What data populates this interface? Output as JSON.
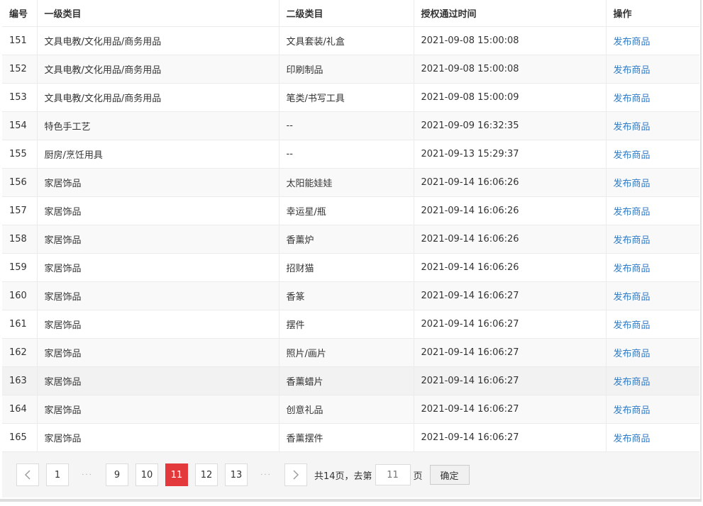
{
  "table": {
    "headers": {
      "id": "编号",
      "level1": "一级类目",
      "level2": "二级类目",
      "time": "授权通过时间",
      "action": "操作"
    },
    "rows": [
      {
        "id": "151",
        "level1": "文具电教/文化用品/商务用品",
        "level2": "文具套装/礼盒",
        "time": "2021-09-08 15:00:08",
        "action": "发布商品"
      },
      {
        "id": "152",
        "level1": "文具电教/文化用品/商务用品",
        "level2": "印刷制品",
        "time": "2021-09-08 15:00:08",
        "action": "发布商品"
      },
      {
        "id": "153",
        "level1": "文具电教/文化用品/商务用品",
        "level2": "笔类/书写工具",
        "time": "2021-09-08 15:00:09",
        "action": "发布商品"
      },
      {
        "id": "154",
        "level1": "特色手工艺",
        "level2": "--",
        "time": "2021-09-09 16:32:35",
        "action": "发布商品"
      },
      {
        "id": "155",
        "level1": "厨房/烹饪用具",
        "level2": "--",
        "time": "2021-09-13 15:29:37",
        "action": "发布商品"
      },
      {
        "id": "156",
        "level1": "家居饰品",
        "level2": "太阳能娃娃",
        "time": "2021-09-14 16:06:26",
        "action": "发布商品"
      },
      {
        "id": "157",
        "level1": "家居饰品",
        "level2": "幸运星/瓶",
        "time": "2021-09-14 16:06:26",
        "action": "发布商品"
      },
      {
        "id": "158",
        "level1": "家居饰品",
        "level2": "香薰炉",
        "time": "2021-09-14 16:06:26",
        "action": "发布商品"
      },
      {
        "id": "159",
        "level1": "家居饰品",
        "level2": "招财猫",
        "time": "2021-09-14 16:06:26",
        "action": "发布商品"
      },
      {
        "id": "160",
        "level1": "家居饰品",
        "level2": "香篆",
        "time": "2021-09-14 16:06:27",
        "action": "发布商品"
      },
      {
        "id": "161",
        "level1": "家居饰品",
        "level2": "摆件",
        "time": "2021-09-14 16:06:27",
        "action": "发布商品"
      },
      {
        "id": "162",
        "level1": "家居饰品",
        "level2": "照片/画片",
        "time": "2021-09-14 16:06:27",
        "action": "发布商品"
      },
      {
        "id": "163",
        "level1": "家居饰品",
        "level2": "香薰蜡片",
        "time": "2021-09-14 16:06:27",
        "action": "发布商品"
      },
      {
        "id": "164",
        "level1": "家居饰品",
        "level2": "创意礼品",
        "time": "2021-09-14 16:06:27",
        "action": "发布商品"
      },
      {
        "id": "165",
        "level1": "家居饰品",
        "level2": "香薰摆件",
        "time": "2021-09-14 16:06:27",
        "action": "发布商品"
      }
    ],
    "hover_row": "163"
  },
  "pagination": {
    "prev_icon": "chevron-left-icon",
    "next_icon": "chevron-right-icon",
    "pages_before": [
      "1"
    ],
    "ellipsis": "···",
    "pages_mid": [
      "9",
      "10"
    ],
    "current": "11",
    "pages_after": [
      "12",
      "13"
    ],
    "total_text": "共14页，去第",
    "jump_value": "11",
    "page_suffix": "页",
    "confirm_label": "确定"
  },
  "colors": {
    "link": "#2f7cc4",
    "active_page": "#e4393c"
  }
}
